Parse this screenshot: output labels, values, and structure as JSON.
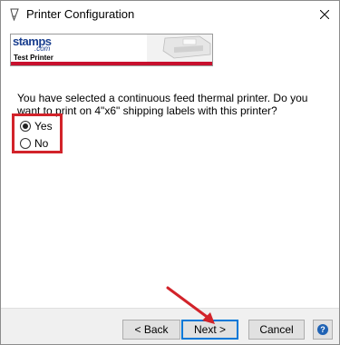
{
  "window": {
    "title": "Printer Configuration",
    "icons": {
      "title": "printer-feather-icon",
      "close": "close-icon"
    }
  },
  "banner": {
    "logo_text": "stamps",
    "logo_suffix": ".com",
    "subtitle": "Test Printer",
    "accent_color": "#c8102e",
    "logo_color": "#1a3f8f"
  },
  "question": {
    "text": "You have selected a continuous feed thermal printer.  Do you want to print on 4\"x6\" shipping labels with this printer?"
  },
  "options": {
    "yes_label": "Yes",
    "no_label": "No",
    "selected": "Yes",
    "highlight_color": "#d2232a"
  },
  "footer": {
    "back_label": "< Back",
    "next_label": "Next >",
    "cancel_label": "Cancel",
    "help_label": "?",
    "icons": {
      "help": "help-icon"
    }
  },
  "annotation": {
    "arrow_color": "#d2232a",
    "arrow_icon": "red-arrow-icon"
  }
}
